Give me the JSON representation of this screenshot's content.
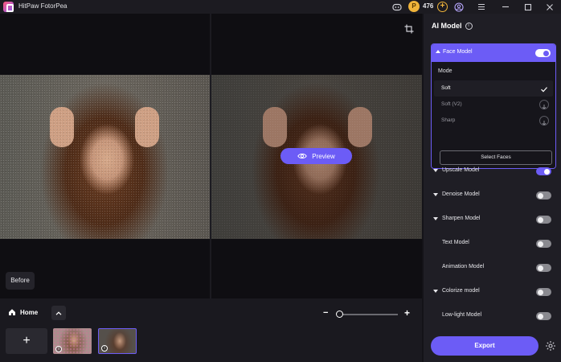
{
  "app": {
    "title": "HitPaw FotorPea",
    "credits": "476",
    "credit_coin_glyph": "P",
    "icons": [
      "discord-icon",
      "coin-icon",
      "add-credit-icon",
      "account-icon",
      "menu-icon",
      "minimize-icon",
      "maximize-icon",
      "close-icon"
    ]
  },
  "canvas": {
    "preview_label": "Preview",
    "before_label": "Before"
  },
  "bottom": {
    "home_label": "Home",
    "add_glyph": "+",
    "zoom_minus": "−",
    "zoom_plus": "+",
    "zoom_level": 0.0,
    "thumbnails": [
      {
        "name": "thumbnail-before",
        "selected": false
      },
      {
        "name": "thumbnail-after",
        "selected": true
      }
    ]
  },
  "panel": {
    "title": "AI Model",
    "face_model": {
      "label": "Face Model",
      "enabled": true,
      "mode_label": "Mode",
      "options": [
        {
          "label": "Soft",
          "selected": true,
          "trail": "check-icon"
        },
        {
          "label": "Soft (V2)",
          "selected": false,
          "trail": "download-icon"
        },
        {
          "label": "Sharp",
          "selected": false,
          "trail": "download-icon"
        }
      ],
      "select_faces_label": "Select Faces"
    },
    "models": [
      {
        "label": "Upscale Model",
        "enabled": true,
        "expandable": true
      },
      {
        "label": "Denoise Model",
        "enabled": false,
        "expandable": true
      },
      {
        "label": "Sharpen Model",
        "enabled": false,
        "expandable": true
      },
      {
        "label": "Text Model",
        "enabled": false,
        "expandable": false
      },
      {
        "label": "Animation Model",
        "enabled": false,
        "expandable": false
      },
      {
        "label": "Colorize model",
        "enabled": false,
        "expandable": true
      },
      {
        "label": "Low-light Model",
        "enabled": false,
        "expandable": false
      }
    ],
    "export_label": "Export"
  },
  "colors": {
    "accent": "#6c5cf6",
    "background": "#141318",
    "panel": "#1f1e25",
    "coin": "#f0b43a"
  }
}
